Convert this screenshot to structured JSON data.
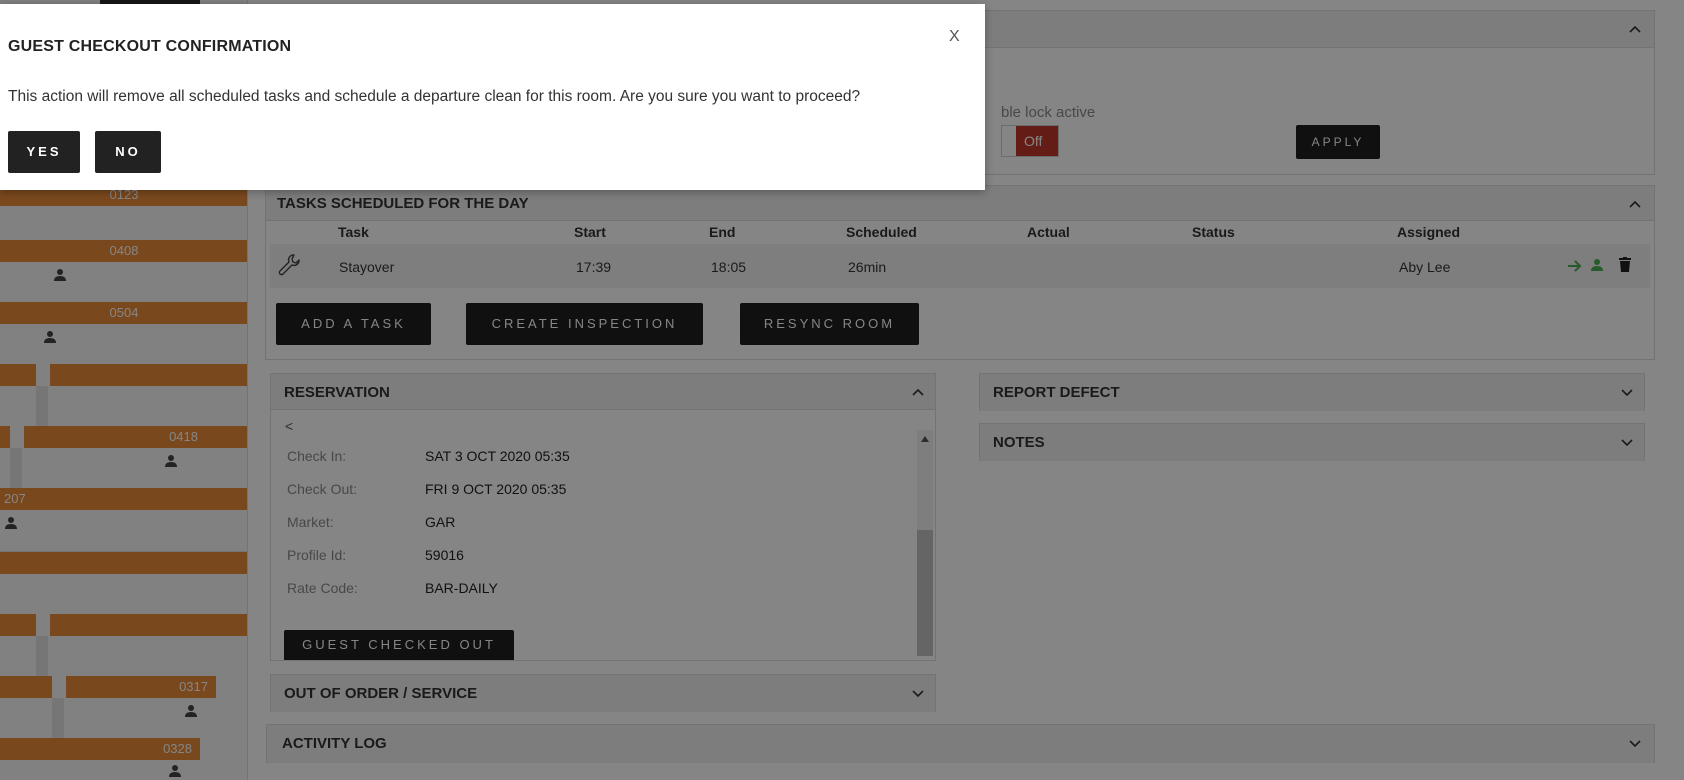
{
  "rooms": {
    "tiles": [
      "0123",
      "0408",
      "0504",
      "0418",
      "207",
      "0317",
      "0328"
    ]
  },
  "room_lock": {
    "label": "ble lock active",
    "toggle_value": "Off",
    "apply_label": "APPLY"
  },
  "tasks": {
    "title": "TASKS SCHEDULED FOR THE DAY",
    "columns": {
      "task": "Task",
      "start": "Start",
      "end": "End",
      "scheduled": "Scheduled",
      "actual": "Actual",
      "status": "Status",
      "assigned": "Assigned"
    },
    "rows": [
      {
        "task": "Stayover",
        "start": "17:39",
        "end": "18:05",
        "scheduled": "26min",
        "actual": "",
        "status": "",
        "assigned": "Aby Lee"
      }
    ],
    "buttons": {
      "add_task": "ADD A TASK",
      "create_inspection": "CREATE INSPECTION",
      "resync_room": "RESYNC ROOM"
    }
  },
  "reservation": {
    "title": "RESERVATION",
    "back": "<",
    "fields": [
      {
        "label": "Check In:",
        "value": "SAT 3 OCT 2020 05:35"
      },
      {
        "label": "Check Out:",
        "value": "FRI 9 OCT 2020 05:35"
      },
      {
        "label": "Market:",
        "value": "GAR"
      },
      {
        "label": "Profile Id:",
        "value": "59016"
      },
      {
        "label": "Rate Code:",
        "value": "BAR-DAILY"
      }
    ],
    "guest_checked_out": "GUEST CHECKED OUT"
  },
  "out_of_order": {
    "title": "OUT OF ORDER / SERVICE"
  },
  "activity_log": {
    "title": "ACTIVITY LOG"
  },
  "report_defect": {
    "title": "REPORT DEFECT"
  },
  "notes": {
    "title": "NOTES"
  },
  "modal": {
    "title": "GUEST CHECKOUT CONFIRMATION",
    "close": "X",
    "message": "This action will remove all scheduled tasks and schedule a departure clean for this room. Are you sure you want to proceed?",
    "yes": "YES",
    "no": "NO"
  },
  "colors": {
    "room_tile": "#e98a38",
    "toggle_off": "#c0392b",
    "assign_green": "#4caf50",
    "button_dark": "#1f1f1f"
  },
  "icons": {
    "task_type": "wrench-icon",
    "row_actions": [
      "arrow-right-icon",
      "person-icon",
      "trash-icon"
    ],
    "collapse": "chevron-up-icon",
    "expand": "chevron-down-icon"
  }
}
